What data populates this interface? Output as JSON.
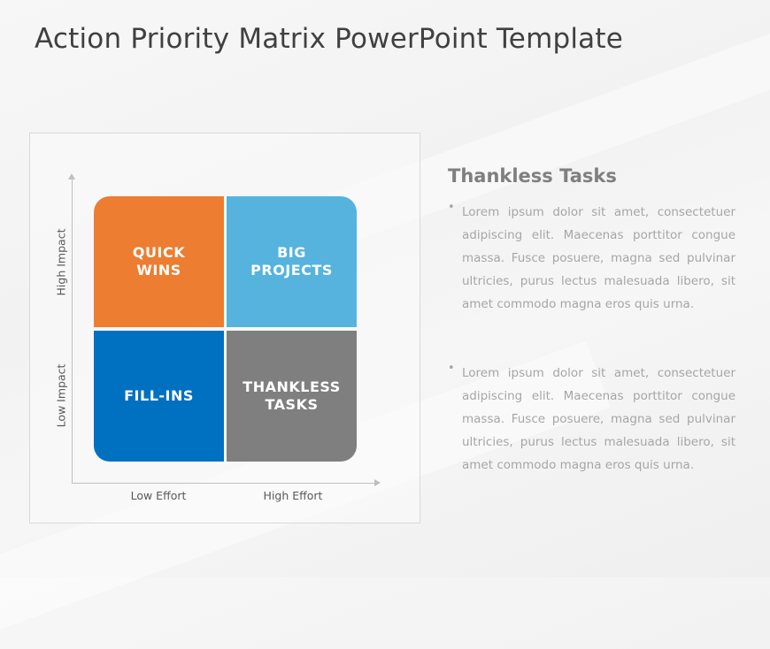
{
  "slide": {
    "title": "Action Priority Matrix PowerPoint Template"
  },
  "matrix": {
    "y_axis": {
      "high_label": "High Impact",
      "low_label": "Low Impact"
    },
    "x_axis": {
      "low_label": "Low Effort",
      "high_label": "High Effort"
    },
    "quadrants": [
      {
        "label": "QUICK WINS",
        "color": "#ED7D31",
        "effort": "low",
        "impact": "high"
      },
      {
        "label": "BIG PROJECTS",
        "color": "#55B3DE",
        "effort": "high",
        "impact": "high"
      },
      {
        "label": "FILL-INS",
        "color": "#0070C0",
        "effort": "low",
        "impact": "low"
      },
      {
        "label": "THANKLESS TASKS",
        "color": "#7F7F7F",
        "effort": "high",
        "impact": "low"
      }
    ]
  },
  "details": {
    "heading": "Thankless Tasks",
    "bullets": [
      "Lorem ipsum dolor sit amet, consectetuer adipiscing elit. Maecenas porttitor congue massa. Fusce posuere, magna sed pulvinar ultricies, purus lectus malesuada libero, sit amet commodo magna eros quis urna.",
      "Lorem ipsum dolor sit amet, consectetuer adipiscing elit. Maecenas porttitor congue massa. Fusce posuere, magna sed pulvinar ultricies, purus lectus malesuada libero, sit amet commodo magna eros quis urna."
    ],
    "bullet_glyph": "•"
  }
}
